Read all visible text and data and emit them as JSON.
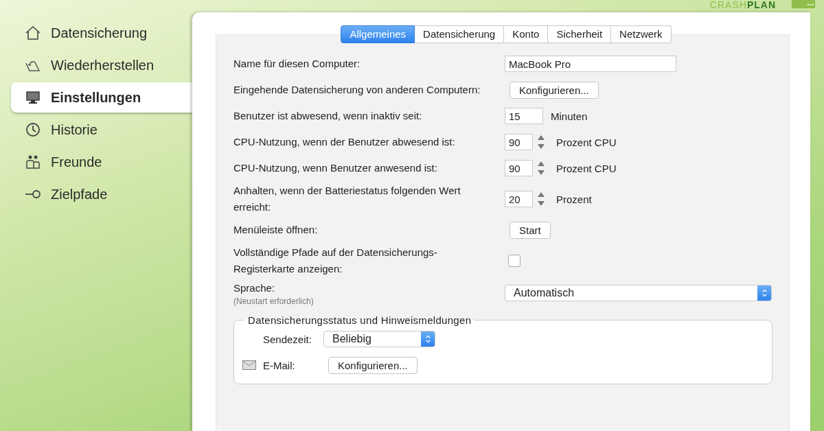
{
  "logo": {
    "light": "CRASH",
    "bold": "PLAN"
  },
  "sidebar": {
    "items": [
      {
        "label": "Datensicherung",
        "selected": false
      },
      {
        "label": "Wiederherstellen",
        "selected": false
      },
      {
        "label": "Einstellungen",
        "selected": true
      },
      {
        "label": "Historie",
        "selected": false
      },
      {
        "label": "Freunde",
        "selected": false
      },
      {
        "label": "Zielpfade",
        "selected": false
      }
    ]
  },
  "tabs": [
    {
      "label": "Allgemeines",
      "selected": true
    },
    {
      "label": "Datensicherung",
      "selected": false
    },
    {
      "label": "Konto",
      "selected": false
    },
    {
      "label": "Sicherheit",
      "selected": false
    },
    {
      "label": "Netzwerk",
      "selected": false
    }
  ],
  "settings": [
    {
      "kind": "text",
      "label": "Name für diesen Computer:",
      "value": "MacBook Pro"
    },
    {
      "kind": "button",
      "label": "Eingehende Datensicherung von anderen Computern:",
      "value": "Konfigurieren..."
    },
    {
      "kind": "number",
      "label": "Benutzer ist abwesend, wenn inaktiv seit:",
      "value": "15",
      "unit": "Minuten"
    },
    {
      "kind": "spinner",
      "label": "CPU-Nutzung, wenn der Benutzer abwesend ist:",
      "value": "90",
      "unit": "Prozent CPU"
    },
    {
      "kind": "spinner",
      "label": "CPU-Nutzung, wenn Benutzer anwesend ist:",
      "value": "90",
      "unit": "Prozent CPU"
    },
    {
      "kind": "spinner",
      "label": "Anhalten, wenn der Batteriestatus folgenden Wert erreicht:",
      "value": "20",
      "unit": "Prozent"
    },
    {
      "kind": "button",
      "label": "Menüleiste öffnen:",
      "value": "Start"
    },
    {
      "kind": "checkbox",
      "label": "Vollständige Pfade auf der Datensicherungs-Registerkarte anzeigen:",
      "checked": false
    },
    {
      "kind": "select",
      "label": "Sprache:",
      "note": "(Neustart erforderlich)",
      "value": "Automatisch"
    }
  ],
  "group": {
    "title": "Datensicherungsstatus und Hinweismeldungen",
    "rows": [
      {
        "kind": "select",
        "label": "Sendezeit:",
        "value": "Beliebig"
      },
      {
        "kind": "button",
        "label": "E-Mail:",
        "value": "Konfigurieren..."
      }
    ]
  }
}
